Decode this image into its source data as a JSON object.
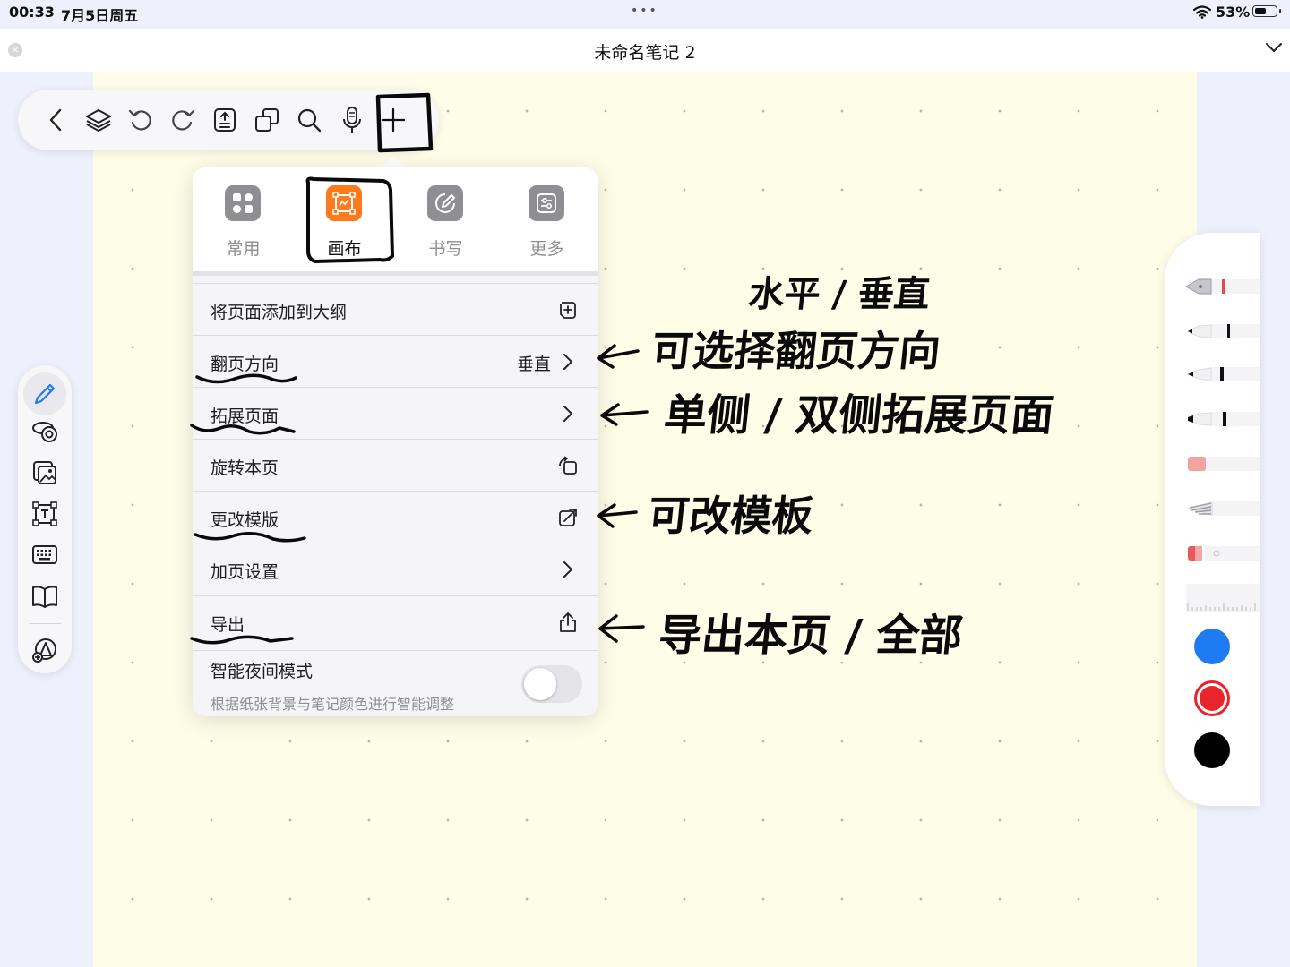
{
  "status": {
    "time": "00:33",
    "date": "7月5日周五",
    "dots": "•••",
    "battery": "53%",
    "battery_level": 0.53
  },
  "titlebar": {
    "title": "未命名笔记 2",
    "close": "×"
  },
  "toolbar": {
    "items": [
      "back-icon",
      "layers-icon",
      "undo-icon",
      "redo-icon",
      "page-info-icon",
      "copy-pages-icon",
      "search-icon",
      "microphone-icon",
      "add-icon"
    ]
  },
  "leftbar": {
    "items": [
      "pencil-icon",
      "lasso-icon",
      "image-icon",
      "textbox-icon",
      "keyboard-icon",
      "book-icon",
      "shapes-icon"
    ]
  },
  "menu": {
    "tabs": [
      {
        "label": "常用",
        "icon": "grid-icon"
      },
      {
        "label": "画布",
        "icon": "canvas-icon",
        "active": true
      },
      {
        "label": "书写",
        "icon": "pen-edit-icon"
      },
      {
        "label": "更多",
        "icon": "sliders-icon"
      }
    ],
    "rows": [
      {
        "label": "将页面添加到大纲",
        "icon": "add-outline-icon"
      },
      {
        "label": "翻页方向",
        "value": "垂直",
        "icon": "chevron-right-icon"
      },
      {
        "label": "拓展页面",
        "icon": "chevron-right-icon"
      },
      {
        "label": "旋转本页",
        "icon": "rotate-icon"
      },
      {
        "label": "更改模版",
        "icon": "change-template-icon"
      },
      {
        "label": "加页设置",
        "icon": "chevron-right-icon"
      },
      {
        "label": "导出",
        "icon": "share-icon"
      }
    ],
    "night": {
      "label": "智能夜间模式",
      "sub": "根据纸张背景与笔记颜色进行智能调整",
      "on": false
    }
  },
  "annotations": {
    "a1_top": "水平 / 垂直",
    "a1": "可选择翻页方向",
    "a2": "单侧 / 双侧拓展页面",
    "a3": "可改模板",
    "a4": "导出本页 / 全部"
  },
  "penbar": {
    "tools": [
      "fountain-pen-icon",
      "ballpoint-pen-icon",
      "fineliner-icon",
      "marker-icon",
      "eraser-icon",
      "pencil-tool-icon",
      "highlighter-icon",
      "ruler-icon"
    ],
    "colors": [
      "#1e7bf2",
      "#e8252a",
      "#000000"
    ]
  }
}
